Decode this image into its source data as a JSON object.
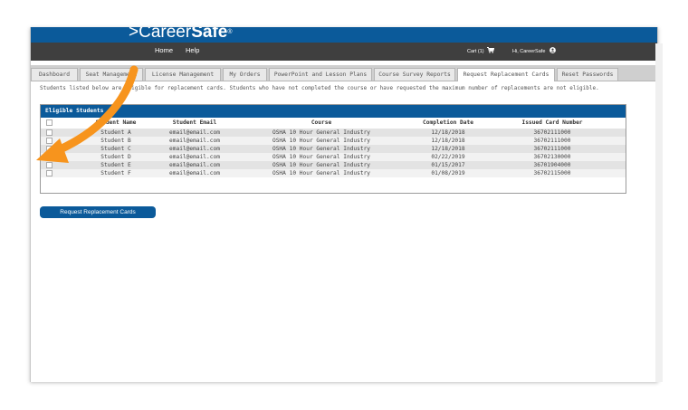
{
  "brand": {
    "logo_prefix": ">",
    "logo_regular": "Career",
    "logo_bold": "Safe",
    "logo_mark": "®",
    "color": "#0b5a9a"
  },
  "nav": {
    "home": "Home",
    "help": "Help",
    "cart": "Cart (1)",
    "cart_icon": "cart-icon",
    "greeting": "Hi, CareerSafe",
    "user_icon": "user-icon"
  },
  "tabs": [
    {
      "label": "Dashboard",
      "active": false
    },
    {
      "label": "Seat Management",
      "active": false
    },
    {
      "label": "License Management",
      "active": false
    },
    {
      "label": "My Orders",
      "active": false
    },
    {
      "label": "PowerPoint and Lesson Plans",
      "active": false
    },
    {
      "label": "Course Survey Reports",
      "active": false
    },
    {
      "label": "Request Replacement Cards",
      "active": true
    },
    {
      "label": "Reset Passwords",
      "active": false
    }
  ],
  "intro_text": "Students listed below are eligible for replacement cards. Students who have not completed the course or have requested the maximum number of replacements are not eligible.",
  "table": {
    "title": "Eligible Students",
    "columns": [
      "Student Name",
      "Student Email",
      "Course",
      "Completion Date",
      "Issued Card Number"
    ],
    "rows": [
      [
        "Student A",
        "email@email.com",
        "OSHA 10 Hour General Industry",
        "12/18/2018",
        "36702111000"
      ],
      [
        "Student B",
        "email@email.com",
        "OSHA 10 Hour General Industry",
        "12/18/2018",
        "36702111000"
      ],
      [
        "Student C",
        "email@email.com",
        "OSHA 10 Hour General Industry",
        "12/18/2018",
        "36702111000"
      ],
      [
        "Student D",
        "email@email.com",
        "OSHA 10 Hour General Industry",
        "02/22/2019",
        "36702130000"
      ],
      [
        "Student E",
        "email@email.com",
        "OSHA 10 Hour General Industry",
        "01/15/2017",
        "36701904000"
      ],
      [
        "Student F",
        "email@email.com",
        "OSHA 10 Hour General Industry",
        "01/08/2019",
        "36702115000"
      ]
    ]
  },
  "action_button": "Request Replacement Cards",
  "annotation": {
    "icon": "arrow-annotation-icon",
    "color": "#f7941d"
  }
}
